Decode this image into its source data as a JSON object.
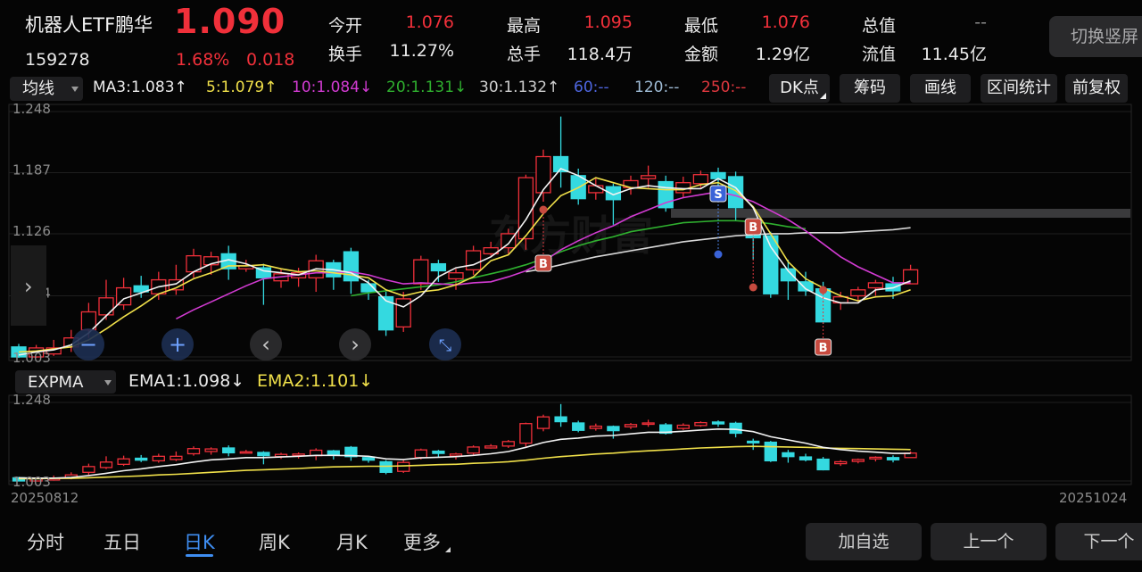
{
  "header": {
    "name": "机器人ETF鹏华",
    "code": "159278",
    "price": "1.090",
    "change_pct": "1.68%",
    "change_val": "0.018"
  },
  "quote": [
    {
      "label": "今开",
      "value": "1.076",
      "color": "red"
    },
    {
      "label": "最高",
      "value": "1.095",
      "color": "red"
    },
    {
      "label": "最低",
      "value": "1.076",
      "color": "red"
    },
    {
      "label": "总值",
      "value": "--",
      "color": "gray"
    },
    {
      "label": "换手",
      "value": "11.27%",
      "color": "white"
    },
    {
      "label": "总手",
      "value": "118.4万",
      "color": "white"
    },
    {
      "label": "金额",
      "value": "1.29亿",
      "color": "white"
    },
    {
      "label": "流值",
      "value": "11.45亿",
      "color": "white"
    }
  ],
  "switch_button": "切换竖屏",
  "toolbar": {
    "indicator": "均线",
    "ma": [
      {
        "text": "MA3:1.083↑",
        "color": "#ececec"
      },
      {
        "text": "5:1.079↑",
        "color": "#f0e04a"
      },
      {
        "text": "10:1.084↓",
        "color": "#d23bd2"
      },
      {
        "text": "20:1.131↓",
        "color": "#2fb02f"
      },
      {
        "text": "30:1.132↑",
        "color": "#cfcfcf"
      },
      {
        "text": "60:--",
        "color": "#4e66e0"
      },
      {
        "text": "120:--",
        "color": "#9fbcd6"
      },
      {
        "text": "250:--",
        "color": "#e0383f"
      }
    ],
    "buttons": [
      "DK点",
      "筹码",
      "画线",
      "区间统计",
      "前复权"
    ]
  },
  "colors": {
    "up": "#f0303a",
    "down": "#34d9e0",
    "ma3": "#f2f2f2",
    "ma5": "#f0e04a",
    "ma10": "#d23bd2",
    "ma20": "#2fb02f",
    "ma30": "#d8d8d8",
    "ema1": "#f2f2f2",
    "ema2": "#f0e04a"
  },
  "main_chart": {
    "y_labels": [
      "1.248",
      "1.187",
      "1.126",
      "1.064",
      "1.003"
    ],
    "watermark": "东方财富",
    "nav": {
      "zoom_out": "−",
      "zoom_in": "+",
      "prev": "‹",
      "next": "›",
      "collapse": "⤡",
      "side_arrow": "›"
    },
    "markers": [
      {
        "label": "B",
        "type": "buy",
        "index": 30
      },
      {
        "label": "S",
        "type": "sell",
        "index": 40
      },
      {
        "label": "B",
        "type": "buy",
        "index": 42
      },
      {
        "label": "B",
        "type": "buy",
        "index": 46
      }
    ]
  },
  "sub_chart": {
    "indicator": "EXPMA",
    "ema1": "EMA1:1.098↓",
    "ema2": "EMA2:1.101↓",
    "y_labels": [
      "1.248",
      "1.003"
    ]
  },
  "dates": {
    "start": "20250812",
    "end": "20251024"
  },
  "tabs": [
    "分时",
    "五日",
    "日K",
    "周K",
    "月K",
    "更多"
  ],
  "active_tab": 2,
  "bottom_buttons": [
    "加自选",
    "上一个",
    "下一个"
  ],
  "chart_data": {
    "type": "candlestick",
    "ylim": [
      1.003,
      1.248
    ],
    "y_ticks": [
      1.248,
      1.187,
      1.126,
      1.064,
      1.003
    ],
    "x_range": [
      "20250812",
      "20251024"
    ],
    "series": [
      {
        "name": "K",
        "ohlc": [
          [
            1.013,
            1.003,
            1.016,
            1.002
          ],
          [
            1.003,
            1.012,
            1.015,
            1.002
          ],
          [
            1.006,
            1.012,
            1.02,
            1.004
          ],
          [
            1.013,
            1.022,
            1.03,
            1.008
          ],
          [
            1.03,
            1.048,
            1.057,
            1.022
          ],
          [
            1.045,
            1.062,
            1.08,
            1.04
          ],
          [
            1.055,
            1.072,
            1.082,
            1.05
          ],
          [
            1.074,
            1.068,
            1.084,
            1.062
          ],
          [
            1.066,
            1.08,
            1.088,
            1.06
          ],
          [
            1.07,
            1.08,
            1.095,
            1.065
          ],
          [
            1.088,
            1.104,
            1.111,
            1.082
          ],
          [
            1.095,
            1.103,
            1.108,
            1.085
          ],
          [
            1.106,
            1.091,
            1.114,
            1.08
          ],
          [
            1.091,
            1.094,
            1.1,
            1.088
          ],
          [
            1.092,
            1.082,
            1.096,
            1.055
          ],
          [
            1.079,
            1.086,
            1.091,
            1.072
          ],
          [
            1.082,
            1.087,
            1.092,
            1.073
          ],
          [
            1.082,
            1.099,
            1.105,
            1.068
          ],
          [
            1.097,
            1.083,
            1.1,
            1.07
          ],
          [
            1.108,
            1.079,
            1.112,
            1.066
          ],
          [
            1.076,
            1.068,
            1.08,
            1.06
          ],
          [
            1.063,
            1.03,
            1.068,
            1.024
          ],
          [
            1.033,
            1.061,
            1.068,
            1.028
          ],
          [
            1.076,
            1.1,
            1.104,
            1.07
          ],
          [
            1.096,
            1.089,
            1.1,
            1.078
          ],
          [
            1.081,
            1.087,
            1.091,
            1.07
          ],
          [
            1.09,
            1.109,
            1.114,
            1.085
          ],
          [
            1.106,
            1.112,
            1.118,
            1.104
          ],
          [
            1.112,
            1.126,
            1.131,
            1.106
          ],
          [
            1.121,
            1.182,
            1.185,
            1.11
          ],
          [
            1.167,
            1.203,
            1.21,
            1.158
          ],
          [
            1.203,
            1.188,
            1.243,
            1.172
          ],
          [
            1.184,
            1.161,
            1.191,
            1.155
          ],
          [
            1.167,
            1.174,
            1.182,
            1.16
          ],
          [
            1.173,
            1.16,
            1.176,
            1.135
          ],
          [
            1.172,
            1.179,
            1.184,
            1.165
          ],
          [
            1.181,
            1.184,
            1.194,
            1.172
          ],
          [
            1.178,
            1.152,
            1.184,
            1.148
          ],
          [
            1.167,
            1.177,
            1.183,
            1.162
          ],
          [
            1.176,
            1.185,
            1.189,
            1.172
          ],
          [
            1.187,
            1.181,
            1.192,
            1.172
          ],
          [
            1.183,
            1.152,
            1.188,
            1.139
          ],
          [
            1.127,
            1.122,
            1.135,
            1.1
          ],
          [
            1.124,
            1.066,
            1.128,
            1.062
          ],
          [
            1.091,
            1.079,
            1.1,
            1.06
          ],
          [
            1.078,
            1.069,
            1.088,
            1.064
          ],
          [
            1.071,
            1.038,
            1.078,
            1.036
          ],
          [
            1.057,
            1.063,
            1.068,
            1.05
          ],
          [
            1.064,
            1.07,
            1.073,
            1.058
          ],
          [
            1.072,
            1.077,
            1.08,
            1.064
          ],
          [
            1.076,
            1.069,
            1.083,
            1.061
          ],
          [
            1.076,
            1.09,
            1.095,
            1.076
          ]
        ]
      },
      {
        "name": "MA3",
        "values": [
          1.005,
          1.008,
          1.01,
          1.015,
          1.027,
          1.044,
          1.061,
          1.067,
          1.073,
          1.076,
          1.088,
          1.096,
          1.1,
          1.096,
          1.089,
          1.087,
          1.085,
          1.091,
          1.09,
          1.087,
          1.077,
          1.059,
          1.053,
          1.064,
          1.083,
          1.092,
          1.095,
          1.103,
          1.116,
          1.14,
          1.17,
          1.191,
          1.184,
          1.174,
          1.165,
          1.171,
          1.174,
          1.172,
          1.171,
          1.171,
          1.181,
          1.172,
          1.152,
          1.113,
          1.089,
          1.071,
          1.062,
          1.057,
          1.057,
          1.07,
          1.072,
          1.079
        ]
      },
      {
        "name": "MA5",
        "values": [
          1.008,
          1.009,
          1.011,
          1.013,
          1.02,
          1.031,
          1.043,
          1.054,
          1.066,
          1.072,
          1.081,
          1.087,
          1.094,
          1.094,
          1.095,
          1.091,
          1.088,
          1.089,
          1.087,
          1.085,
          1.082,
          1.07,
          1.064,
          1.068,
          1.07,
          1.075,
          1.083,
          1.099,
          1.105,
          1.124,
          1.146,
          1.164,
          1.172,
          1.182,
          1.177,
          1.172,
          1.171,
          1.17,
          1.17,
          1.175,
          1.177,
          1.169,
          1.153,
          1.126,
          1.098,
          1.081,
          1.072,
          1.064,
          1.059,
          1.063,
          1.064,
          1.07
        ]
      },
      {
        "name": "MA10",
        "values": [
          null,
          null,
          null,
          null,
          null,
          null,
          null,
          null,
          null,
          1.041,
          1.05,
          1.058,
          1.066,
          1.074,
          1.081,
          1.083,
          1.085,
          1.087,
          1.087,
          1.088,
          1.085,
          1.08,
          1.076,
          1.077,
          1.076,
          1.075,
          1.077,
          1.078,
          1.083,
          1.089,
          1.098,
          1.11,
          1.119,
          1.127,
          1.134,
          1.143,
          1.15,
          1.157,
          1.162,
          1.165,
          1.168,
          1.164,
          1.158,
          1.149,
          1.14,
          1.129,
          1.116,
          1.103,
          1.093,
          1.085,
          1.077,
          1.077
        ]
      },
      {
        "name": "MA20",
        "values": [
          null,
          null,
          null,
          null,
          null,
          null,
          null,
          null,
          null,
          null,
          null,
          null,
          null,
          null,
          null,
          null,
          null,
          null,
          null,
          1.064,
          1.067,
          1.069,
          1.071,
          1.073,
          1.075,
          1.078,
          1.082,
          1.086,
          1.09,
          1.095,
          1.101,
          1.108,
          1.114,
          1.119,
          1.123,
          1.128,
          1.131,
          1.134,
          1.137,
          1.138,
          1.139,
          1.139,
          1.138,
          1.136,
          1.133,
          1.131
        ]
      },
      {
        "name": "MA30",
        "values": [
          null,
          null,
          null,
          null,
          null,
          null,
          null,
          null,
          null,
          null,
          null,
          null,
          null,
          null,
          null,
          null,
          null,
          null,
          null,
          null,
          null,
          null,
          null,
          null,
          null,
          null,
          null,
          null,
          null,
          1.088,
          1.091,
          1.095,
          1.099,
          1.103,
          1.106,
          1.109,
          1.112,
          1.115,
          1.118,
          1.12,
          1.122,
          1.124,
          1.125,
          1.126,
          1.126,
          1.127,
          1.127,
          1.127,
          1.128,
          1.129,
          1.13,
          1.132
        ]
      },
      {
        "name": "EMA1",
        "values": [
          1.013,
          1.012,
          1.012,
          1.014,
          1.02,
          1.027,
          1.035,
          1.041,
          1.048,
          1.054,
          1.062,
          1.069,
          1.072,
          1.076,
          1.076,
          1.078,
          1.08,
          1.083,
          1.083,
          1.082,
          1.08,
          1.072,
          1.07,
          1.075,
          1.077,
          1.079,
          1.083,
          1.088,
          1.095,
          1.108,
          1.123,
          1.133,
          1.137,
          1.143,
          1.145,
          1.15,
          1.155,
          1.155,
          1.158,
          1.162,
          1.165,
          1.164,
          1.157,
          1.141,
          1.131,
          1.121,
          1.108,
          1.101,
          1.096,
          1.093,
          1.089,
          1.089
        ]
      },
      {
        "name": "EMA2",
        "values": [
          1.01,
          1.01,
          1.011,
          1.011,
          1.013,
          1.015,
          1.017,
          1.019,
          1.022,
          1.024,
          1.027,
          1.03,
          1.033,
          1.036,
          1.038,
          1.04,
          1.042,
          1.045,
          1.047,
          1.048,
          1.049,
          1.049,
          1.05,
          1.052,
          1.054,
          1.055,
          1.058,
          1.06,
          1.063,
          1.068,
          1.074,
          1.079,
          1.083,
          1.087,
          1.09,
          1.094,
          1.097,
          1.1,
          1.103,
          1.106,
          1.108,
          1.11,
          1.111,
          1.11,
          1.109,
          1.108,
          1.106,
          1.105,
          1.104,
          1.103,
          1.102,
          1.101
        ]
      }
    ]
  }
}
